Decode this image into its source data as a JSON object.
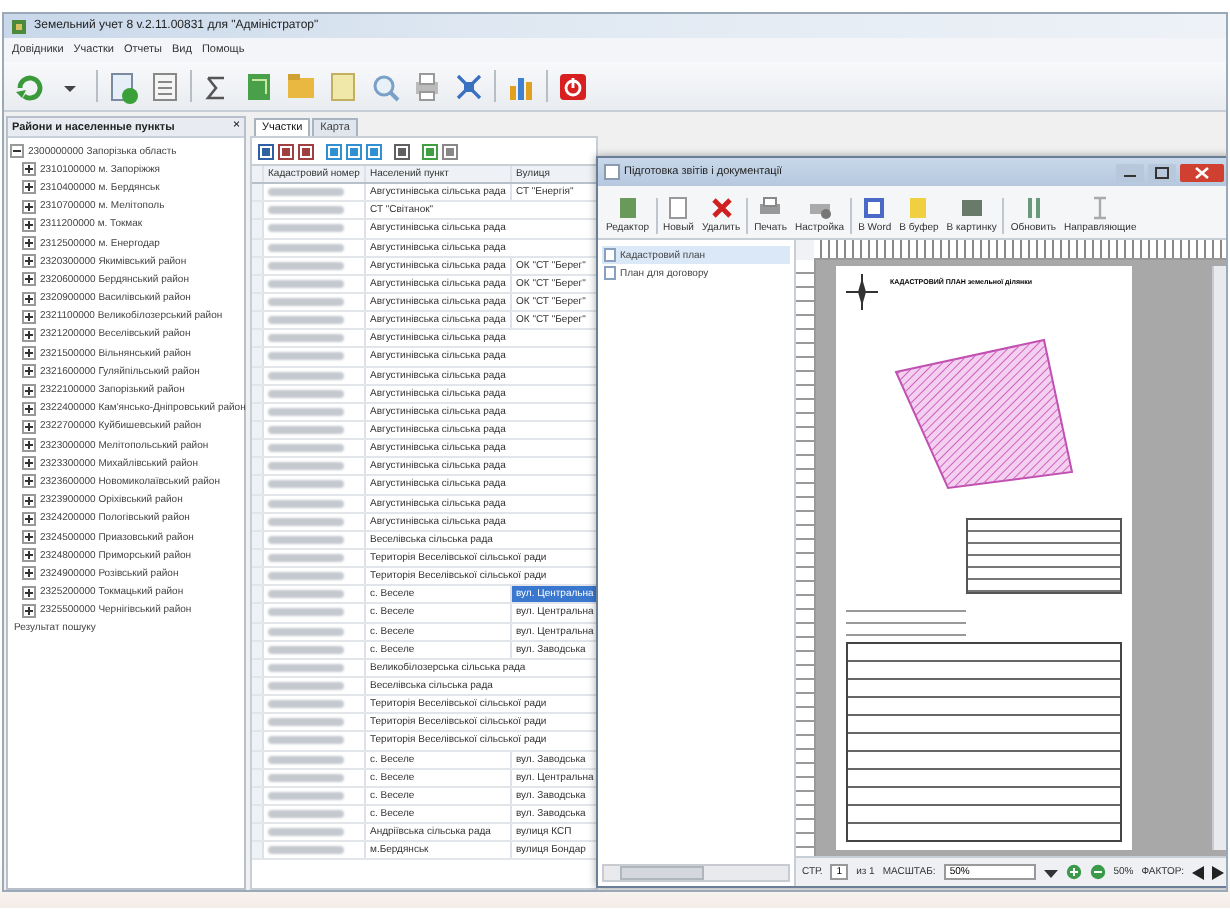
{
  "window": {
    "title": "Земельний учет 8 v.2.11.00831 для \"Адміністратор\""
  },
  "menu": [
    "Довідники",
    "Участки",
    "Отчеты",
    "Вид",
    "Помощь"
  ],
  "left_panel": {
    "title": "Райони и населенные пункты",
    "close": "×",
    "tree": [
      {
        "label": "2300000000 Запорізька область",
        "expanded": true,
        "children": [
          {
            "label": "2310100000 м. Запоріжжя",
            "expanded": false
          },
          {
            "label": "2310400000 м. Бердянськ",
            "expanded": false
          },
          {
            "label": "2310700000 м. Мелітополь",
            "expanded": false
          },
          {
            "label": "2311200000 м. Токмак",
            "expanded": false
          },
          {
            "label": "2312500000 м. Енергодар",
            "expanded": false
          },
          {
            "label": "2320300000 Якимівський район",
            "expanded": false
          },
          {
            "label": "2320600000 Бердянський район",
            "expanded": false
          },
          {
            "label": "2320900000 Василівський район",
            "expanded": false
          },
          {
            "label": "2321100000 Великобілозерський район",
            "expanded": false
          },
          {
            "label": "2321200000 Веселівський район",
            "expanded": false
          },
          {
            "label": "2321500000 Вільнянський район",
            "expanded": false
          },
          {
            "label": "2321600000 Гуляйпільський район",
            "expanded": false
          },
          {
            "label": "2322100000 Запорізький район",
            "expanded": false
          },
          {
            "label": "2322400000 Кам'янсько-Дніпровський район",
            "expanded": false
          },
          {
            "label": "2322700000 Куйбишевський район",
            "expanded": false
          },
          {
            "label": "2323000000 Мелітопольський район",
            "expanded": false
          },
          {
            "label": "2323300000 Михайлівський район",
            "expanded": false
          },
          {
            "label": "2323600000 Новомиколаївський район",
            "expanded": false
          },
          {
            "label": "2323900000 Оріхівський район",
            "expanded": false
          },
          {
            "label": "2324200000 Пологівський район",
            "expanded": false
          },
          {
            "label": "2324500000 Приазовський район",
            "expanded": false
          },
          {
            "label": "2324800000 Приморський район",
            "expanded": false
          },
          {
            "label": "2324900000 Розівський район",
            "expanded": false
          },
          {
            "label": "2325200000 Токмацький район",
            "expanded": false
          },
          {
            "label": "2325500000 Чернігівський район",
            "expanded": false
          }
        ]
      },
      {
        "label": "Результат пошуку"
      }
    ]
  },
  "tabs": [
    {
      "label": "Участки",
      "selected": true
    },
    {
      "label": "Карта",
      "selected": false
    }
  ],
  "grid": {
    "columns": [
      "Кадастровий номер",
      "Населений пункт",
      "Вулиця"
    ],
    "rows": [
      {
        "settlement": "Августинівська сільська рада",
        "street": "СТ \"Енергія\"",
        "selected": false
      },
      {
        "settlement": "СТ \"Світанок\"",
        "selected": false
      },
      {
        "settlement": "Августинівська сільська рада",
        "selected": false
      },
      {
        "settlement": "Августинівська сільська рада",
        "selected": false
      },
      {
        "settlement": "Августинівська сільська рада",
        "street": "ОК \"СТ \"Берег\"",
        "selected": false
      },
      {
        "settlement": "Августинівська сільська рада",
        "street": "ОК \"СТ \"Берег\"",
        "selected": false
      },
      {
        "settlement": "Августинівська сільська рада",
        "street": "ОК \"СТ \"Берег\"",
        "selected": false
      },
      {
        "settlement": "Августинівська сільська рада",
        "street": "ОК \"СТ \"Берег\"",
        "selected": false
      },
      {
        "settlement": "Августинівська сільська рада",
        "selected": false
      },
      {
        "settlement": "Августинівська сільська рада",
        "selected": false
      },
      {
        "settlement": "Августинівська сільська рада",
        "selected": false
      },
      {
        "settlement": "Августинівська сільська рада",
        "selected": false
      },
      {
        "settlement": "Августинівська сільська рада",
        "selected": false
      },
      {
        "settlement": "Августинівська сільська рада",
        "selected": false
      },
      {
        "settlement": "Августинівська сільська рада",
        "selected": false
      },
      {
        "settlement": "Августинівська сільська рада",
        "selected": false
      },
      {
        "settlement": "Августинівська сільська рада",
        "selected": false
      },
      {
        "settlement": "Августинівська сільська рада",
        "selected": false
      },
      {
        "settlement": "Августинівська сільська рада",
        "selected": false
      },
      {
        "settlement": "Веселівська сільська рада",
        "selected": false
      },
      {
        "settlement": "Територія Веселівської сільської ради",
        "selected": false
      },
      {
        "settlement": "Територія Веселівської сільської ради",
        "selected": false
      },
      {
        "settlement": "с. Веселе",
        "street": "вул. Центральна",
        "selected": true
      },
      {
        "settlement": "с. Веселе",
        "street": "вул. Центральна",
        "selected": false
      },
      {
        "settlement": "с. Веселе",
        "street": "вул. Центральна",
        "selected": false
      },
      {
        "settlement": "с. Веселе",
        "street": "вул. Заводська",
        "selected": false
      },
      {
        "settlement": "Великобілозерська сільська рада",
        "selected": false
      },
      {
        "settlement": "Веселівська сільська рада",
        "selected": false
      },
      {
        "settlement": "Територія Веселівської сільської ради",
        "selected": false
      },
      {
        "settlement": "Територія Веселівської сільської ради",
        "selected": false
      },
      {
        "settlement": "Територія Веселівської сільської ради",
        "selected": false
      },
      {
        "settlement": "с. Веселе",
        "street": "вул. Заводська",
        "selected": false
      },
      {
        "settlement": "с. Веселе",
        "street": "вул. Центральна",
        "selected": false
      },
      {
        "settlement": "с. Веселе",
        "street": "вул. Заводська",
        "selected": false
      },
      {
        "settlement": "с. Веселе",
        "street": "вул. Заводська",
        "selected": false
      },
      {
        "settlement": "Андріївська сільська рада",
        "street": "вулиця КСП",
        "selected": false
      },
      {
        "settlement": "м.Бердянськ",
        "street": "вулиця Бондар",
        "selected": false
      }
    ]
  },
  "dialog": {
    "title": "Підготовка звітів і документації",
    "toolbar": [
      "Редактор",
      "Новый",
      "Удалить",
      "Печать",
      "Настройка",
      "В Word",
      "В буфер",
      "В картинку",
      "Обновить",
      "Направляющие"
    ],
    "templates": [
      {
        "label": "Кадастровий план",
        "selected": true
      },
      {
        "label": "План для договору",
        "selected": false
      }
    ],
    "page_title": "КАДАСТРОВИЙ ПЛАН земельної ділянки",
    "status": {
      "page_label": "СТР.",
      "page": "1",
      "of": "из 1",
      "scale_label": "МАСШТАБ:",
      "scale": "50%",
      "zoom": "50%",
      "factor_label": "ФАКТОР:"
    }
  }
}
